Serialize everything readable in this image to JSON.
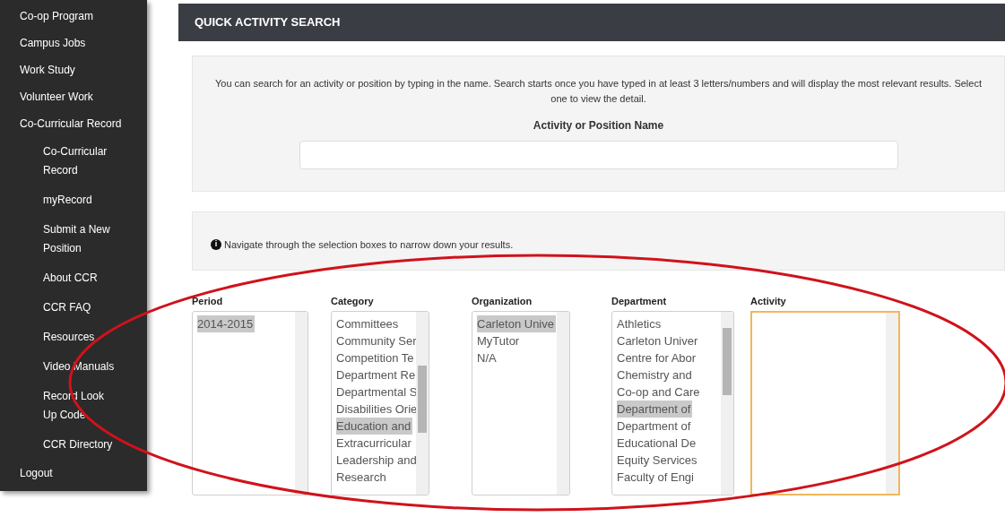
{
  "sidebar": {
    "items": [
      {
        "label": "Co-op Program"
      },
      {
        "label": "Campus Jobs"
      },
      {
        "label": "Work Study"
      },
      {
        "label": "Volunteer Work"
      },
      {
        "label": "Co-Curricular Record",
        "children": [
          {
            "label": "Co-Curricular Record"
          },
          {
            "label": "myRecord"
          },
          {
            "label": "Submit a New Position"
          },
          {
            "label": "About CCR"
          },
          {
            "label": "CCR FAQ"
          },
          {
            "label": "Resources"
          },
          {
            "label": "Video Manuals"
          },
          {
            "label": "Record Look Up Code"
          },
          {
            "label": "CCR Directory"
          }
        ]
      },
      {
        "label": "Logout"
      }
    ]
  },
  "header": {
    "title": "QUICK ACTIVITY SEARCH"
  },
  "search": {
    "description": "You can search for an activity or position by typing in the name. Search starts once you have typed in at least 3 letters/numbers and will display the most relevant results. Select one to view the detail.",
    "label": "Activity or Position Name"
  },
  "info": {
    "icon_text": "i",
    "text": "Navigate through the selection boxes to narrow down your results."
  },
  "lists": [
    {
      "label": "Period",
      "focused": false,
      "items": [
        {
          "text": "2014-2015",
          "selected": true
        }
      ]
    },
    {
      "label": "Category",
      "focused": false,
      "items": [
        {
          "text": "Committees",
          "selected": false
        },
        {
          "text": "Community Ser",
          "selected": false
        },
        {
          "text": "Competition Te",
          "selected": false
        },
        {
          "text": "Department Re",
          "selected": false
        },
        {
          "text": "Departmental S",
          "selected": false
        },
        {
          "text": "Disabilities Orie",
          "selected": false
        },
        {
          "text": "Education and",
          "selected": true
        },
        {
          "text": "Extracurricular",
          "selected": false
        },
        {
          "text": "Leadership and",
          "selected": false
        },
        {
          "text": "Research",
          "selected": false
        }
      ]
    },
    {
      "label": "Organization",
      "focused": false,
      "items": [
        {
          "text": "Carleton Unive",
          "selected": true
        },
        {
          "text": "MyTutor",
          "selected": false
        },
        {
          "text": "N/A",
          "selected": false
        }
      ]
    },
    {
      "label": "Department",
      "focused": false,
      "items": [
        {
          "text": "Athletics",
          "selected": false
        },
        {
          "text": "Carleton Univer",
          "selected": false
        },
        {
          "text": "Centre for Abor",
          "selected": false
        },
        {
          "text": "Chemistry and",
          "selected": false
        },
        {
          "text": "Co-op and Care",
          "selected": false
        },
        {
          "text": "Department of",
          "selected": true
        },
        {
          "text": "Department of",
          "selected": false
        },
        {
          "text": "Educational De",
          "selected": false
        },
        {
          "text": "Equity Services",
          "selected": false
        },
        {
          "text": "Faculty of Engi",
          "selected": false
        }
      ]
    },
    {
      "label": "Activity",
      "focused": true
    }
  ]
}
